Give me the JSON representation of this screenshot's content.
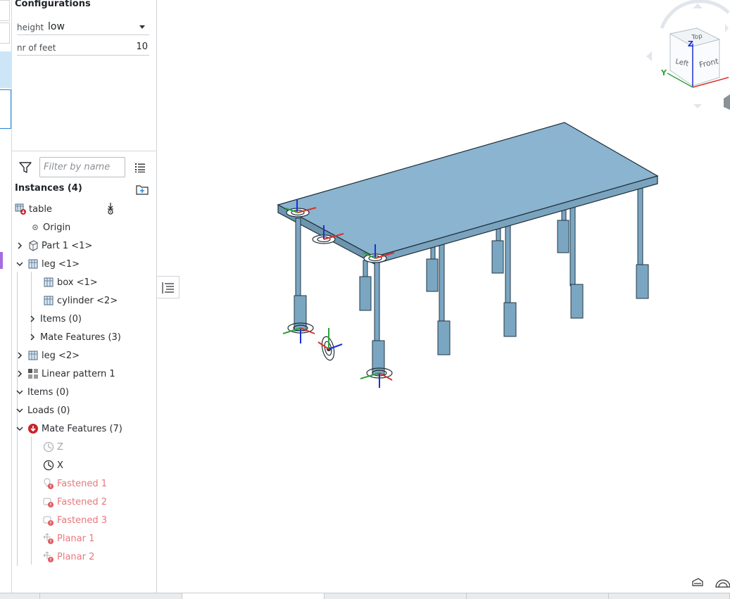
{
  "configurations": {
    "title": "Configurations",
    "height": {
      "label": "height",
      "value": "low"
    },
    "feet": {
      "label": "nr of feet",
      "value": "10"
    }
  },
  "filter": {
    "placeholder": "Filter by name"
  },
  "instances": {
    "title": "Instances (4)",
    "tree": {
      "table": "table",
      "origin": "Origin",
      "part1": "Part 1 <1>",
      "leg1": "leg <1>",
      "box1": "box <1>",
      "cylinder2": "cylinder <2>",
      "leg1_items": "Items (0)",
      "leg1_mates": "Mate Features (3)",
      "leg2": "leg <2>",
      "pattern": "Linear pattern 1",
      "items": "Items (0)",
      "loads": "Loads (0)",
      "mates": "Mate Features (7)",
      "mate_z": "Z",
      "mate_x": "X",
      "fastened1": "Fastened 1",
      "fastened2": "Fastened 2",
      "fastened3": "Fastened 3",
      "planar1": "Planar 1",
      "planar2": "Planar 2"
    }
  },
  "viewcube": {
    "top": "Top",
    "left": "Left",
    "front": "Front",
    "z": "Z",
    "y": "Y"
  },
  "colors": {
    "accent": "#2a83d6",
    "error": "#e7797d",
    "model": "#8ab4cf"
  }
}
